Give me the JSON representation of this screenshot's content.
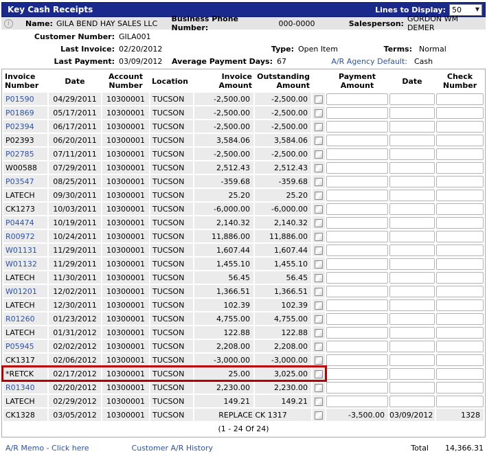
{
  "titlebar": {
    "title": "Key Cash Receipts",
    "lines_to_display_label": "Lines to Display:",
    "lines_to_display_value": "50"
  },
  "customer": {
    "name_label": "Name:",
    "name": "GILA BEND HAY SALES LLC",
    "phone_label": "Business Phone Number:",
    "phone": "000-0000",
    "salesperson_label": "Salesperson:",
    "salesperson": "GORDON WM DEMER",
    "customer_number_label": "Customer Number:",
    "customer_number": "GILA001",
    "last_invoice_label": "Last Invoice:",
    "last_invoice": "02/20/2012",
    "type_label": "Type:",
    "type": "Open Item",
    "terms_label": "Terms:",
    "terms": "Normal",
    "last_payment_label": "Last Payment:",
    "last_payment": "03/09/2012",
    "avg_payment_days_label": "Average Payment Days:",
    "avg_payment_days": "67",
    "ar_agency_default_label": "A/R Agency Default:",
    "ar_agency_default": "Cash"
  },
  "table": {
    "columns": [
      "Invoice\nNumber",
      "Date",
      "Account\nNumber",
      "Location",
      "Invoice\nAmount",
      "Outstanding\nAmount",
      "",
      "Payment\nAmount",
      "Date",
      "Check\nNumber"
    ],
    "rows": [
      {
        "invoice": "P01590",
        "is_link": true,
        "date": "04/29/2011",
        "account": "10300001",
        "location": "TUCSON",
        "invoice_amount": "-2,500.00",
        "outstanding_amount": "-2,500.00"
      },
      {
        "invoice": "P01869",
        "is_link": true,
        "date": "05/17/2011",
        "account": "10300001",
        "location": "TUCSON",
        "invoice_amount": "-2,500.00",
        "outstanding_amount": "-2,500.00"
      },
      {
        "invoice": "P02394",
        "is_link": true,
        "date": "06/17/2011",
        "account": "10300001",
        "location": "TUCSON",
        "invoice_amount": "-2,500.00",
        "outstanding_amount": "-2,500.00"
      },
      {
        "invoice": "P02393",
        "is_link": false,
        "date": "06/20/2011",
        "account": "10300001",
        "location": "TUCSON",
        "invoice_amount": "3,584.06",
        "outstanding_amount": "3,584.06"
      },
      {
        "invoice": "P02785",
        "is_link": true,
        "date": "07/11/2011",
        "account": "10300001",
        "location": "TUCSON",
        "invoice_amount": "-2,500.00",
        "outstanding_amount": "-2,500.00"
      },
      {
        "invoice": "W00588",
        "is_link": false,
        "date": "07/29/2011",
        "account": "10300001",
        "location": "TUCSON",
        "invoice_amount": "2,512.43",
        "outstanding_amount": "2,512.43"
      },
      {
        "invoice": "P03547",
        "is_link": true,
        "date": "08/25/2011",
        "account": "10300001",
        "location": "TUCSON",
        "invoice_amount": "-359.68",
        "outstanding_amount": "-359.68"
      },
      {
        "invoice": "LATECH",
        "is_link": false,
        "date": "09/30/2011",
        "account": "10300001",
        "location": "TUCSON",
        "invoice_amount": "25.20",
        "outstanding_amount": "25.20"
      },
      {
        "invoice": "CK1273",
        "is_link": false,
        "date": "10/03/2011",
        "account": "10300001",
        "location": "TUCSON",
        "invoice_amount": "-6,000.00",
        "outstanding_amount": "-6,000.00"
      },
      {
        "invoice": "P04474",
        "is_link": true,
        "date": "10/19/2011",
        "account": "10300001",
        "location": "TUCSON",
        "invoice_amount": "2,140.32",
        "outstanding_amount": "2,140.32"
      },
      {
        "invoice": "R00972",
        "is_link": true,
        "date": "10/24/2011",
        "account": "10300001",
        "location": "TUCSON",
        "invoice_amount": "11,886.00",
        "outstanding_amount": "11,886.00"
      },
      {
        "invoice": "W01131",
        "is_link": true,
        "date": "11/29/2011",
        "account": "10300001",
        "location": "TUCSON",
        "invoice_amount": "1,607.44",
        "outstanding_amount": "1,607.44"
      },
      {
        "invoice": "W01132",
        "is_link": true,
        "date": "11/29/2011",
        "account": "10300001",
        "location": "TUCSON",
        "invoice_amount": "1,455.10",
        "outstanding_amount": "1,455.10"
      },
      {
        "invoice": "LATECH",
        "is_link": false,
        "date": "11/30/2011",
        "account": "10300001",
        "location": "TUCSON",
        "invoice_amount": "56.45",
        "outstanding_amount": "56.45"
      },
      {
        "invoice": "W01201",
        "is_link": true,
        "date": "12/02/2011",
        "account": "10300001",
        "location": "TUCSON",
        "invoice_amount": "1,366.51",
        "outstanding_amount": "1,366.51"
      },
      {
        "invoice": "LATECH",
        "is_link": false,
        "date": "12/30/2011",
        "account": "10300001",
        "location": "TUCSON",
        "invoice_amount": "102.39",
        "outstanding_amount": "102.39"
      },
      {
        "invoice": "R01260",
        "is_link": true,
        "date": "01/23/2012",
        "account": "10300001",
        "location": "TUCSON",
        "invoice_amount": "4,755.00",
        "outstanding_amount": "4,755.00"
      },
      {
        "invoice": "LATECH",
        "is_link": false,
        "date": "01/31/2012",
        "account": "10300001",
        "location": "TUCSON",
        "invoice_amount": "122.88",
        "outstanding_amount": "122.88"
      },
      {
        "invoice": "P05945",
        "is_link": true,
        "date": "02/02/2012",
        "account": "10300001",
        "location": "TUCSON",
        "invoice_amount": "2,208.00",
        "outstanding_amount": "2,208.00"
      },
      {
        "invoice": "CK1317",
        "is_link": false,
        "date": "02/06/2012",
        "account": "10300001",
        "location": "TUCSON",
        "invoice_amount": "-3,000.00",
        "outstanding_amount": "-3,000.00"
      },
      {
        "invoice": "*RETCK",
        "is_link": false,
        "date": "02/17/2012",
        "account": "10300001",
        "location": "TUCSON",
        "invoice_amount": "25.00",
        "outstanding_amount": "3,025.00",
        "highlighted": true
      },
      {
        "invoice": "R01340",
        "is_link": true,
        "date": "02/20/2012",
        "account": "10300001",
        "location": "TUCSON",
        "invoice_amount": "2,230.00",
        "outstanding_amount": "2,230.00"
      },
      {
        "invoice": "LATECH",
        "is_link": false,
        "date": "02/29/2012",
        "account": "10300001",
        "location": "TUCSON",
        "invoice_amount": "149.21",
        "outstanding_amount": "149.21"
      },
      {
        "invoice": "CK1328",
        "is_link": false,
        "date": "03/05/2012",
        "account": "10300001",
        "location": "TUCSON",
        "note": "REPLACE CK 1317",
        "payment_amount": "-3,500.00",
        "payment_date": "03/09/2012",
        "check_number": "1328"
      }
    ],
    "pagination": "(1 - 24 Of 24)"
  },
  "footer": {
    "ar_memo_link": "A/R Memo - Click here",
    "customer_ar_history_link": "Customer A/R History",
    "total_label": "Total",
    "total_value": "14,366.31"
  },
  "colors": {
    "titlebar_bg": "#19298c",
    "infobar_bg": "#e4e4e4",
    "row_bg": "#ebebeb",
    "link": "#2c52a8",
    "highlight_border": "#b70000"
  }
}
